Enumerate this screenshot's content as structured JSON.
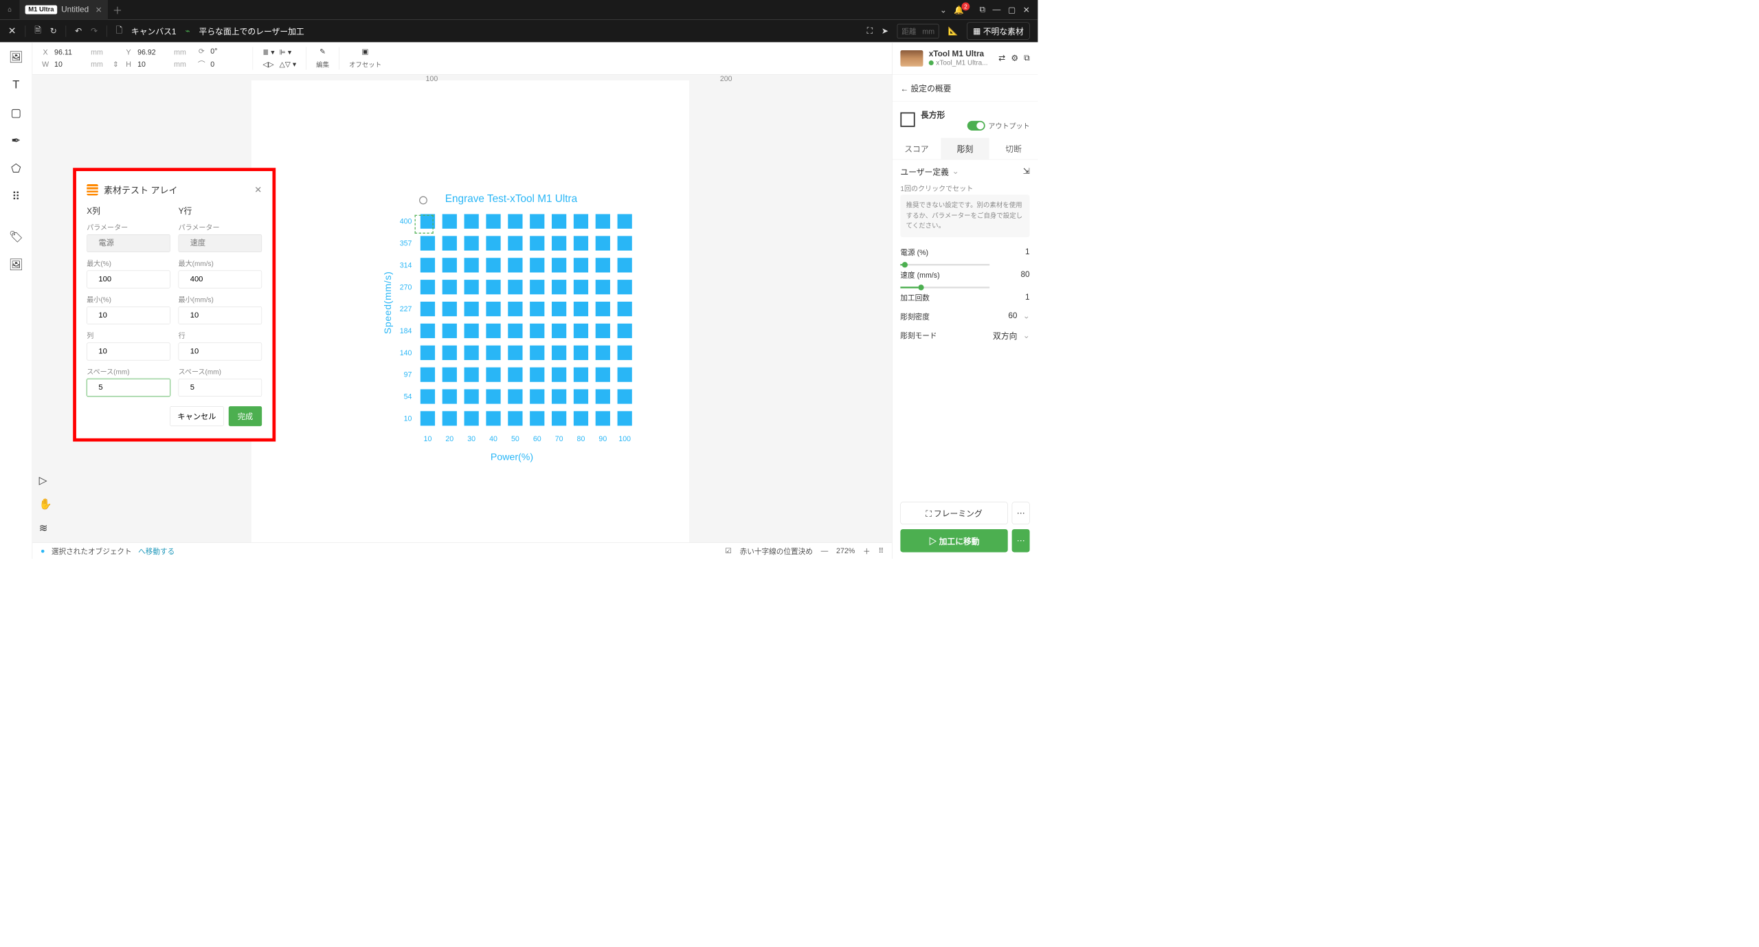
{
  "titlebar": {
    "device_badge": "M1 Ultra",
    "doc": "Untitled",
    "notif_count": "2"
  },
  "topbar": {
    "canvas_label": "キャンバス1",
    "mode_label": "平らな面上でのレーザー加工",
    "distance_placeholder": "距離",
    "distance_unit": "mm",
    "material_label": "不明な素材"
  },
  "props": {
    "x_val": "96.11",
    "y_val": "96.92",
    "w_val": "10",
    "h_val": "10",
    "rot_val": "0°",
    "corner_val": "0",
    "unit": "mm",
    "edit_label": "編集",
    "offset_label": "オフセット"
  },
  "chart_data": {
    "type": "heatmap",
    "title": "Engrave Test-xTool M1 Ultra",
    "xlabel": "Power(%)",
    "ylabel": "Speed(mm/s)",
    "x_ticks": [
      "10",
      "20",
      "30",
      "40",
      "50",
      "60",
      "70",
      "80",
      "90",
      "100"
    ],
    "y_ticks": [
      "400",
      "357",
      "314",
      "270",
      "227",
      "184",
      "140",
      "97",
      "54",
      "10"
    ],
    "grid_rows": 10,
    "grid_cols": 10,
    "cell_color": "#29b6f6"
  },
  "dialog": {
    "title": "素材テスト アレイ",
    "xcol": "X列",
    "yrow": "Y行",
    "param": "パラメーター",
    "x_param_ph": "電源",
    "y_param_ph": "速度",
    "max_pct": "最大(%)",
    "max_mms": "最大(mm/s)",
    "min_pct": "最小(%)",
    "min_mms": "最小(mm/s)",
    "cols": "列",
    "rows": "行",
    "space_mm": "スペース(mm)",
    "v_max_pct": "100",
    "v_max_mms": "400",
    "v_min_pct": "10",
    "v_min_mms": "10",
    "v_cols": "10",
    "v_rows": "10",
    "v_space_x": "5",
    "v_space_y": "5",
    "cancel": "キャンセル",
    "ok": "完成"
  },
  "rightpanel": {
    "device_name": "xTool M1 Ultra",
    "device_conn": "xTool_M1 Ultra...",
    "settings_overview": "設定の概要",
    "shape": "長方形",
    "output": "アウトプット",
    "tab_score": "スコア",
    "tab_engrave": "彫刻",
    "tab_cut": "切断",
    "userdef": "ユーザー定義",
    "oneclick": "1回のクリックでセット",
    "recommend": "推奨できない設定です。別の素材を使用するか、パラメーターをご自身で設定してください。",
    "power": "電源 (%)",
    "power_val": "1",
    "speed": "速度 (mm/s)",
    "speed_val": "80",
    "pass": "加工回数",
    "pass_val": "1",
    "density": "彫刻密度",
    "density_val": "60",
    "mode": "彫刻モード",
    "mode_val": "双方向",
    "framing": "フレーミング",
    "process": "加工に移動"
  },
  "status": {
    "selected": "選択されたオブジェクト",
    "move_here": "へ移動する",
    "crosshair": "赤い十字線の位置決め",
    "zoom": "272%"
  }
}
